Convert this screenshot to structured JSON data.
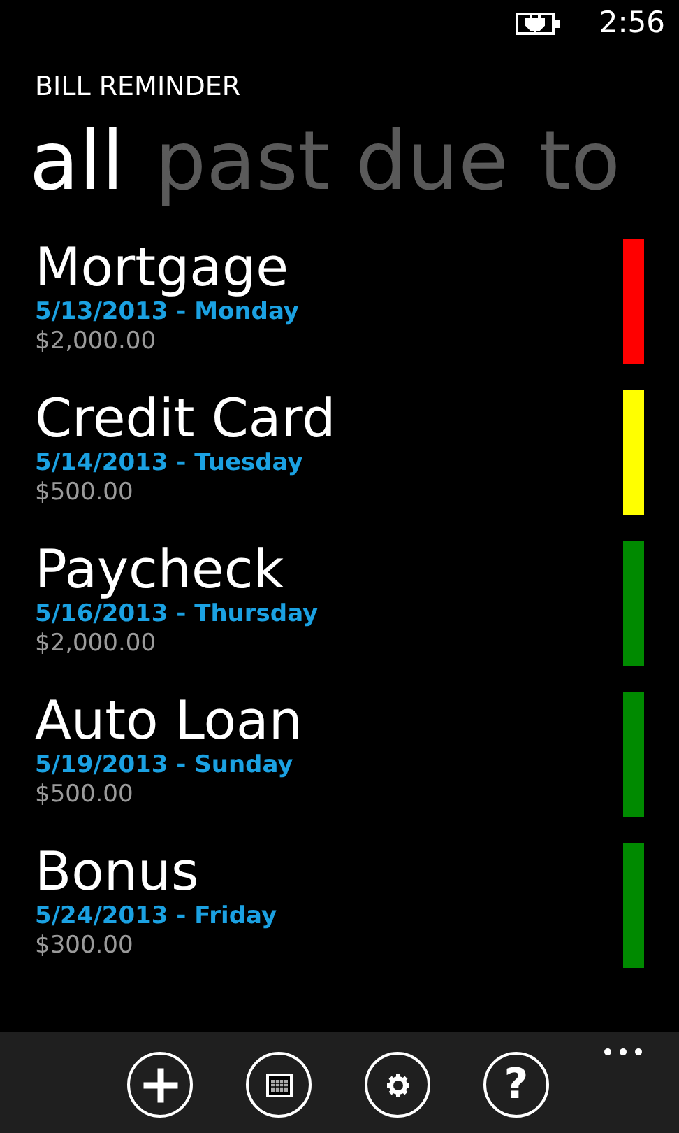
{
  "status_bar": {
    "time": "2:56"
  },
  "app_title": "BILL REMINDER",
  "pivots": [
    {
      "label": "all",
      "selected": true
    },
    {
      "label": "past due",
      "selected": false
    },
    {
      "label": "to",
      "selected": false
    }
  ],
  "bills": [
    {
      "name": "Mortgage",
      "date": "5/13/2013 - Monday",
      "amount": "$2,000.00",
      "color": "#ff0000"
    },
    {
      "name": "Credit Card",
      "date": "5/14/2013 - Tuesday",
      "amount": "$500.00",
      "color": "#ffff00"
    },
    {
      "name": "Paycheck",
      "date": "5/16/2013 - Thursday",
      "amount": "$2,000.00",
      "color": "#008a00"
    },
    {
      "name": "Auto Loan",
      "date": "5/19/2013 - Sunday",
      "amount": "$500.00",
      "color": "#008a00"
    },
    {
      "name": "Bonus",
      "date": "5/24/2013 - Friday",
      "amount": "$300.00",
      "color": "#008a00"
    }
  ],
  "app_bar": {
    "buttons": [
      {
        "kind": "add"
      },
      {
        "kind": "calendar"
      },
      {
        "kind": "settings"
      },
      {
        "kind": "help",
        "glyph": "?"
      }
    ]
  }
}
